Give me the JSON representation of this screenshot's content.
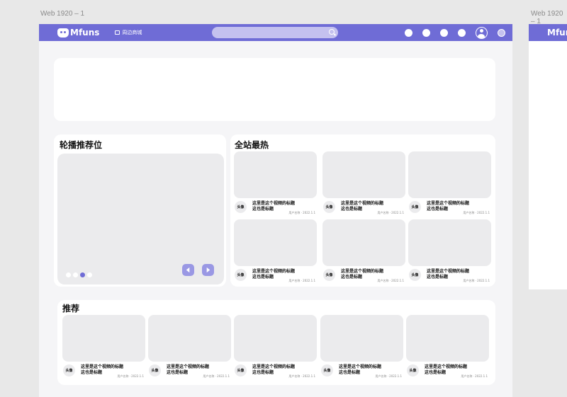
{
  "canvas": {
    "frame1_label": "Web 1920 – 1",
    "frame2_label": "Web 1920 – 1"
  },
  "header": {
    "brand": "Mfuns",
    "nav_shop": "周边商城",
    "search_placeholder": "",
    "brand_color": "#6f6cd6",
    "icons": [
      "game-icon",
      "settings-icon",
      "clock-icon",
      "message-icon",
      "avatar-icon",
      "ring-icon"
    ]
  },
  "sections": {
    "carousel_title": "轮播推荐位",
    "hot_title": "全站最热",
    "recommend_title": "推荐"
  },
  "carousel": {
    "dots": 4,
    "active_dot": 3
  },
  "hot_videos": [
    {
      "avatar": "头像",
      "title1": "这里是这个视频的标题",
      "title2": "这也是标题",
      "sub": "用户名称 · 2022.1.1"
    },
    {
      "avatar": "头像",
      "title1": "这里是这个视频的标题",
      "title2": "这也是标题",
      "sub": "用户名称 · 2022.1.1"
    },
    {
      "avatar": "头像",
      "title1": "这里是这个视频的标题",
      "title2": "这也是标题",
      "sub": "用户名称 · 2022.1.1"
    },
    {
      "avatar": "头像",
      "title1": "这里是这个视频的标题",
      "title2": "这也是标题",
      "sub": "用户名称 · 2022.1.1"
    },
    {
      "avatar": "头像",
      "title1": "这里是这个视频的标题",
      "title2": "这也是标题",
      "sub": "用户名称 · 2022.1.1"
    },
    {
      "avatar": "头像",
      "title1": "这里是这个视频的标题",
      "title2": "这也是标题",
      "sub": "用户名称 · 2022.1.1"
    }
  ],
  "recommend_videos": [
    {
      "avatar": "头像",
      "title1": "这里是这个视频的标题",
      "title2": "这也是标题",
      "sub": "用户名称 · 2022.1.1"
    },
    {
      "avatar": "头像",
      "title1": "这里是这个视频的标题",
      "title2": "这也是标题",
      "sub": "用户名称 · 2022.1.1"
    },
    {
      "avatar": "头像",
      "title1": "这里是这个视频的标题",
      "title2": "这也是标题",
      "sub": "用户名称 · 2022.1.1"
    },
    {
      "avatar": "头像",
      "title1": "这里是这个视频的标题",
      "title2": "这也是标题",
      "sub": "用户名称 · 2022.1.1"
    },
    {
      "avatar": "头像",
      "title1": "这里是这个视频的标题",
      "title2": "这也是标题",
      "sub": "用户名称 · 2022.1.1"
    }
  ]
}
